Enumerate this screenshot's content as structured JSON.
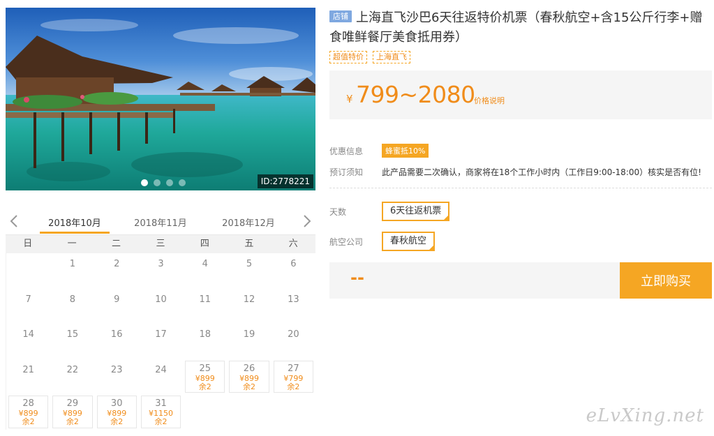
{
  "gallery": {
    "image_id": "ID:2778221",
    "dots": 4,
    "active_dot": 0
  },
  "calendar": {
    "months": [
      "2018年10月",
      "2018年11月",
      "2018年12月"
    ],
    "active_month": 0,
    "weekdays": [
      "日",
      "一",
      "二",
      "三",
      "四",
      "五",
      "六"
    ],
    "leading_blanks": 1,
    "days": [
      {
        "d": "1"
      },
      {
        "d": "2"
      },
      {
        "d": "3"
      },
      {
        "d": "4"
      },
      {
        "d": "5"
      },
      {
        "d": "6"
      },
      {
        "d": "7"
      },
      {
        "d": "8"
      },
      {
        "d": "9"
      },
      {
        "d": "10"
      },
      {
        "d": "11"
      },
      {
        "d": "12"
      },
      {
        "d": "13"
      },
      {
        "d": "14"
      },
      {
        "d": "15"
      },
      {
        "d": "16"
      },
      {
        "d": "17"
      },
      {
        "d": "18"
      },
      {
        "d": "19"
      },
      {
        "d": "20"
      },
      {
        "d": "21"
      },
      {
        "d": "22"
      },
      {
        "d": "23"
      },
      {
        "d": "24"
      },
      {
        "d": "25",
        "price": "¥899",
        "left": "余2"
      },
      {
        "d": "26",
        "price": "¥899",
        "left": "余2"
      },
      {
        "d": "27",
        "price": "¥799",
        "left": "余2"
      },
      {
        "d": "28",
        "price": "¥899",
        "left": "余2"
      },
      {
        "d": "29",
        "price": "¥899",
        "left": "余2"
      },
      {
        "d": "30",
        "price": "¥899",
        "left": "余2"
      },
      {
        "d": "31",
        "price": "¥1150",
        "left": "余2"
      }
    ]
  },
  "product": {
    "shop_tag": "店铺",
    "title": "上海直飞沙巴6天往返特价机票（春秋航空+含15公斤行李+赠食唯鲜餐厅美食抵用券）",
    "tags": [
      "超值特价",
      "上海直飞"
    ],
    "price_symbol": "¥",
    "price_range": "799~2080",
    "price_note": "价格说明",
    "discount_label": "优惠信息",
    "discount_badge": "蜂蜜抵10%",
    "notice_label": "预订须知",
    "notice_text": "此产品需要二次确认，商家将在18个工作小时内（工作日9:00-18:00）核实是否有位!",
    "days_label": "天数",
    "days_option": "6天往返机票",
    "airline_label": "航空公司",
    "airline_option": "春秋航空",
    "total": "--",
    "buy_label": "立即购买"
  },
  "watermark": "eLvXing.net",
  "colors": {
    "accent": "#f5a623",
    "price": "#f08c1a",
    "shop_tag": "#7fa8e0"
  }
}
